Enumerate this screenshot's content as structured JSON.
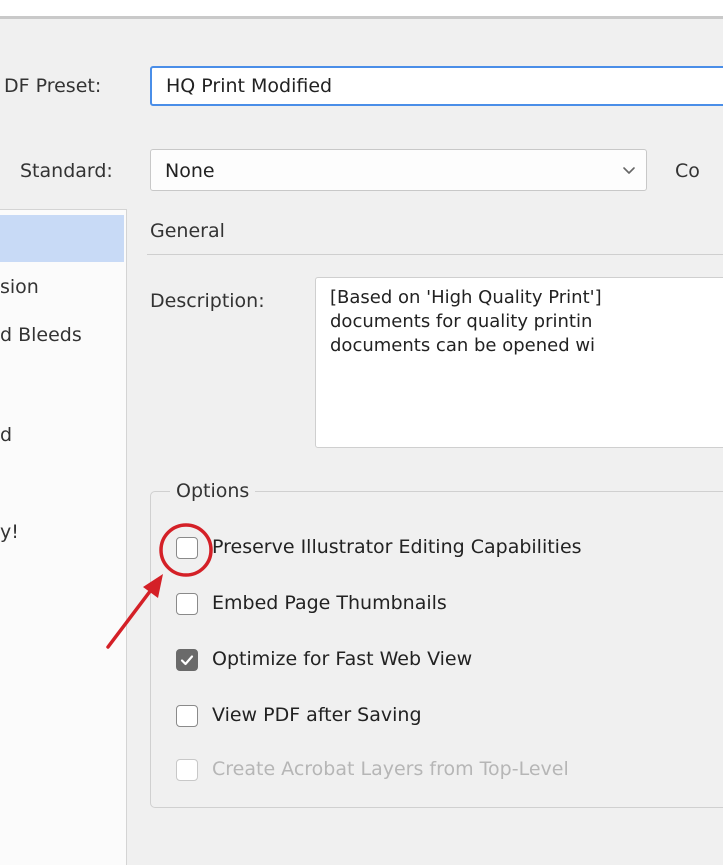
{
  "labels": {
    "pdf_preset": "DF Preset:",
    "standard": "Standard:",
    "compat_partial": "Co",
    "description": "Description:"
  },
  "preset": {
    "value": "HQ Print Modified"
  },
  "standard": {
    "value": "None"
  },
  "sidebar": {
    "items": [
      {
        "label": "sion"
      },
      {
        "label": "d Bleeds"
      },
      {
        "label": "d"
      },
      {
        "label": "y!"
      }
    ]
  },
  "general": {
    "title": "General"
  },
  "description_lines": [
    "[Based on 'High Quality Print']",
    "documents for quality printin",
    "documents can be opened wi"
  ],
  "options": {
    "legend": "Options",
    "items": [
      {
        "label": "Preserve Illustrator Editing Capabilities",
        "checked": false,
        "disabled": false
      },
      {
        "label": "Embed Page Thumbnails",
        "checked": false,
        "disabled": false
      },
      {
        "label": "Optimize for Fast Web View",
        "checked": true,
        "disabled": false
      },
      {
        "label": "View PDF after Saving",
        "checked": false,
        "disabled": false
      },
      {
        "label": "Create Acrobat Layers from Top-Level",
        "checked": false,
        "disabled": true
      }
    ]
  },
  "colors": {
    "annotation": "#d42027",
    "focus_border": "#4a8ee8",
    "selection": "#c8daf6"
  },
  "icons": {
    "select_chevron": "chevron-down-icon",
    "checkmark": "checkmark-icon",
    "annotation_arrow": "arrow-icon"
  }
}
